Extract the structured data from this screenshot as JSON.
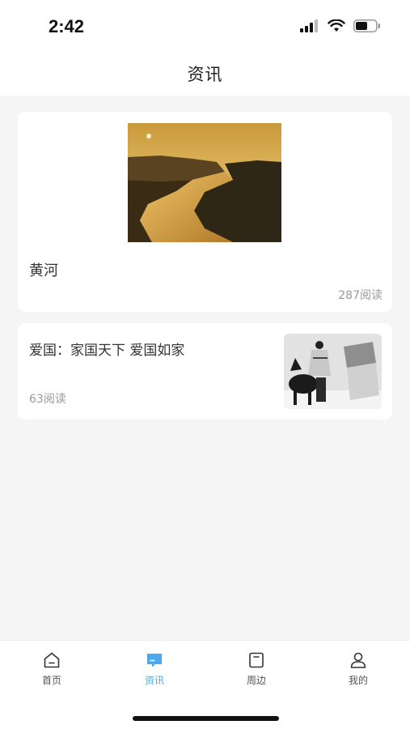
{
  "status_bar": {
    "time": "2:42"
  },
  "header": {
    "title": "资讯"
  },
  "articles": [
    {
      "title": "黄河",
      "reads": "287阅读"
    },
    {
      "title": "爱国：家国天下 爱国如家",
      "reads": "63阅读"
    }
  ],
  "tab_bar": {
    "items": [
      {
        "label": "首页",
        "icon": "home-icon"
      },
      {
        "label": "资讯",
        "icon": "message-icon",
        "active": true
      },
      {
        "label": "周边",
        "icon": "square-icon"
      },
      {
        "label": "我的",
        "icon": "user-icon"
      }
    ]
  },
  "colors": {
    "accent": "#4aa8ee",
    "background": "#f5f5f5",
    "card": "#ffffff"
  }
}
